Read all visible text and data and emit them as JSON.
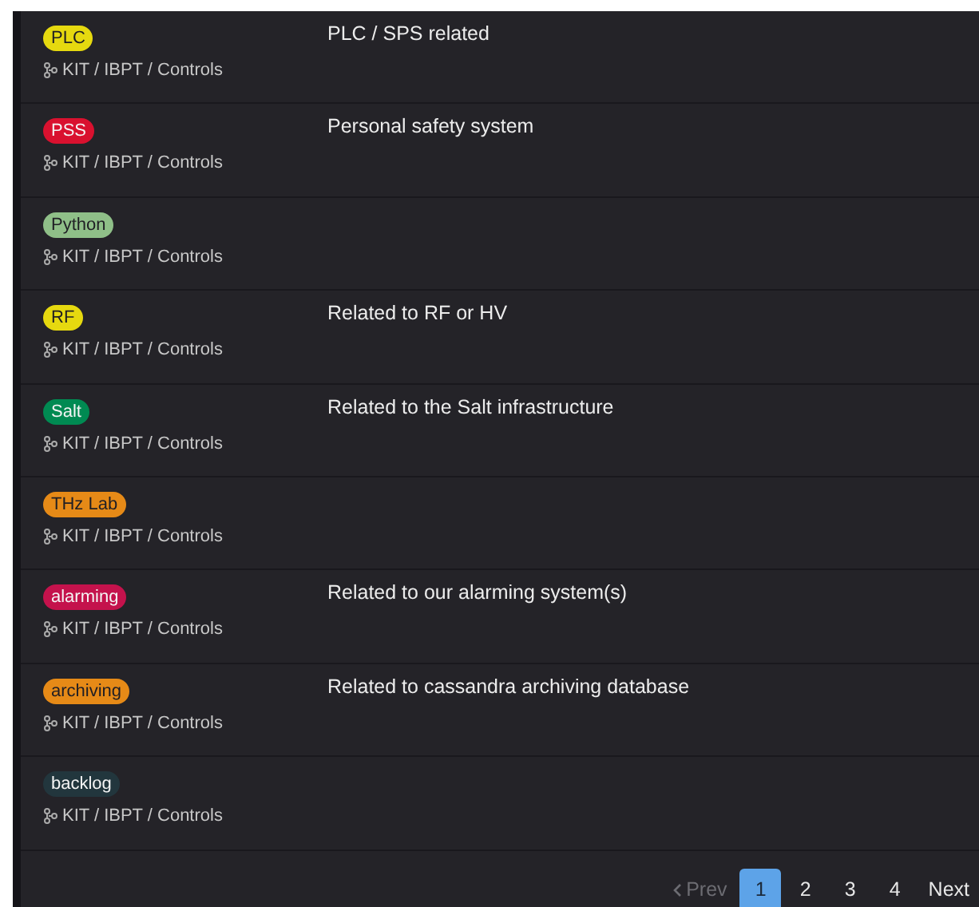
{
  "labels": [
    {
      "name": "PLC",
      "color": "#e6d90f",
      "path": "KIT / IBPT / Controls",
      "description": "PLC / SPS related"
    },
    {
      "name": "PSS",
      "color": "#d9112f",
      "path": "KIT / IBPT / Controls",
      "description": "Personal safety system"
    },
    {
      "name": "Python",
      "color": "#8fbf88",
      "path": "KIT / IBPT / Controls"
    },
    {
      "name": "RF",
      "color": "#e6d90f",
      "path": "KIT / IBPT / Controls",
      "description": "Related to RF or HV"
    },
    {
      "name": "Salt",
      "color": "#008a52",
      "path": "KIT / IBPT / Controls",
      "description": "Related to the Salt infrastructure"
    },
    {
      "name": "THz Lab",
      "color": "#e68a17",
      "path": "KIT / IBPT / Controls"
    },
    {
      "name": "alarming",
      "color": "#c4124c",
      "path": "KIT / IBPT / Controls",
      "description": "Related to our alarming system(s)"
    },
    {
      "name": "archiving",
      "color": "#e68a17",
      "path": "KIT / IBPT / Controls",
      "description": "Related to cassandra archiving database"
    },
    {
      "name": "backlog",
      "color": "#22363d",
      "path": "KIT / IBPT / Controls"
    }
  ],
  "pagination": {
    "prev": {
      "label": "Prev",
      "disabled": true
    },
    "pages": [
      {
        "label": "1",
        "selected": true
      },
      {
        "label": "2",
        "selected": false
      },
      {
        "label": "3",
        "selected": false
      },
      {
        "label": "4",
        "selected": false
      }
    ],
    "next": {
      "label": "Next",
      "disabled": false
    }
  }
}
